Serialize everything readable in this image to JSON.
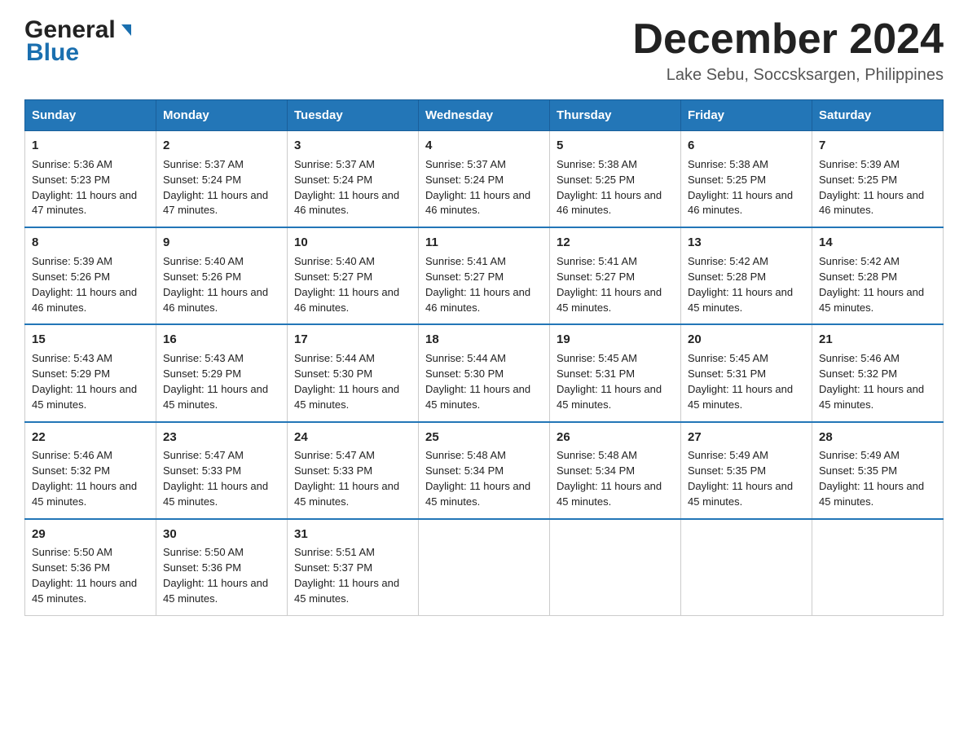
{
  "header": {
    "logo_general": "General",
    "logo_blue": "Blue",
    "main_title": "December 2024",
    "subtitle": "Lake Sebu, Soccsksargen, Philippines"
  },
  "calendar": {
    "days_of_week": [
      "Sunday",
      "Monday",
      "Tuesday",
      "Wednesday",
      "Thursday",
      "Friday",
      "Saturday"
    ],
    "weeks": [
      [
        {
          "day": "1",
          "sunrise": "5:36 AM",
          "sunset": "5:23 PM",
          "daylight": "11 hours and 47 minutes."
        },
        {
          "day": "2",
          "sunrise": "5:37 AM",
          "sunset": "5:24 PM",
          "daylight": "11 hours and 47 minutes."
        },
        {
          "day": "3",
          "sunrise": "5:37 AM",
          "sunset": "5:24 PM",
          "daylight": "11 hours and 46 minutes."
        },
        {
          "day": "4",
          "sunrise": "5:37 AM",
          "sunset": "5:24 PM",
          "daylight": "11 hours and 46 minutes."
        },
        {
          "day": "5",
          "sunrise": "5:38 AM",
          "sunset": "5:25 PM",
          "daylight": "11 hours and 46 minutes."
        },
        {
          "day": "6",
          "sunrise": "5:38 AM",
          "sunset": "5:25 PM",
          "daylight": "11 hours and 46 minutes."
        },
        {
          "day": "7",
          "sunrise": "5:39 AM",
          "sunset": "5:25 PM",
          "daylight": "11 hours and 46 minutes."
        }
      ],
      [
        {
          "day": "8",
          "sunrise": "5:39 AM",
          "sunset": "5:26 PM",
          "daylight": "11 hours and 46 minutes."
        },
        {
          "day": "9",
          "sunrise": "5:40 AM",
          "sunset": "5:26 PM",
          "daylight": "11 hours and 46 minutes."
        },
        {
          "day": "10",
          "sunrise": "5:40 AM",
          "sunset": "5:27 PM",
          "daylight": "11 hours and 46 minutes."
        },
        {
          "day": "11",
          "sunrise": "5:41 AM",
          "sunset": "5:27 PM",
          "daylight": "11 hours and 46 minutes."
        },
        {
          "day": "12",
          "sunrise": "5:41 AM",
          "sunset": "5:27 PM",
          "daylight": "11 hours and 45 minutes."
        },
        {
          "day": "13",
          "sunrise": "5:42 AM",
          "sunset": "5:28 PM",
          "daylight": "11 hours and 45 minutes."
        },
        {
          "day": "14",
          "sunrise": "5:42 AM",
          "sunset": "5:28 PM",
          "daylight": "11 hours and 45 minutes."
        }
      ],
      [
        {
          "day": "15",
          "sunrise": "5:43 AM",
          "sunset": "5:29 PM",
          "daylight": "11 hours and 45 minutes."
        },
        {
          "day": "16",
          "sunrise": "5:43 AM",
          "sunset": "5:29 PM",
          "daylight": "11 hours and 45 minutes."
        },
        {
          "day": "17",
          "sunrise": "5:44 AM",
          "sunset": "5:30 PM",
          "daylight": "11 hours and 45 minutes."
        },
        {
          "day": "18",
          "sunrise": "5:44 AM",
          "sunset": "5:30 PM",
          "daylight": "11 hours and 45 minutes."
        },
        {
          "day": "19",
          "sunrise": "5:45 AM",
          "sunset": "5:31 PM",
          "daylight": "11 hours and 45 minutes."
        },
        {
          "day": "20",
          "sunrise": "5:45 AM",
          "sunset": "5:31 PM",
          "daylight": "11 hours and 45 minutes."
        },
        {
          "day": "21",
          "sunrise": "5:46 AM",
          "sunset": "5:32 PM",
          "daylight": "11 hours and 45 minutes."
        }
      ],
      [
        {
          "day": "22",
          "sunrise": "5:46 AM",
          "sunset": "5:32 PM",
          "daylight": "11 hours and 45 minutes."
        },
        {
          "day": "23",
          "sunrise": "5:47 AM",
          "sunset": "5:33 PM",
          "daylight": "11 hours and 45 minutes."
        },
        {
          "day": "24",
          "sunrise": "5:47 AM",
          "sunset": "5:33 PM",
          "daylight": "11 hours and 45 minutes."
        },
        {
          "day": "25",
          "sunrise": "5:48 AM",
          "sunset": "5:34 PM",
          "daylight": "11 hours and 45 minutes."
        },
        {
          "day": "26",
          "sunrise": "5:48 AM",
          "sunset": "5:34 PM",
          "daylight": "11 hours and 45 minutes."
        },
        {
          "day": "27",
          "sunrise": "5:49 AM",
          "sunset": "5:35 PM",
          "daylight": "11 hours and 45 minutes."
        },
        {
          "day": "28",
          "sunrise": "5:49 AM",
          "sunset": "5:35 PM",
          "daylight": "11 hours and 45 minutes."
        }
      ],
      [
        {
          "day": "29",
          "sunrise": "5:50 AM",
          "sunset": "5:36 PM",
          "daylight": "11 hours and 45 minutes."
        },
        {
          "day": "30",
          "sunrise": "5:50 AM",
          "sunset": "5:36 PM",
          "daylight": "11 hours and 45 minutes."
        },
        {
          "day": "31",
          "sunrise": "5:51 AM",
          "sunset": "5:37 PM",
          "daylight": "11 hours and 45 minutes."
        },
        null,
        null,
        null,
        null
      ]
    ]
  }
}
